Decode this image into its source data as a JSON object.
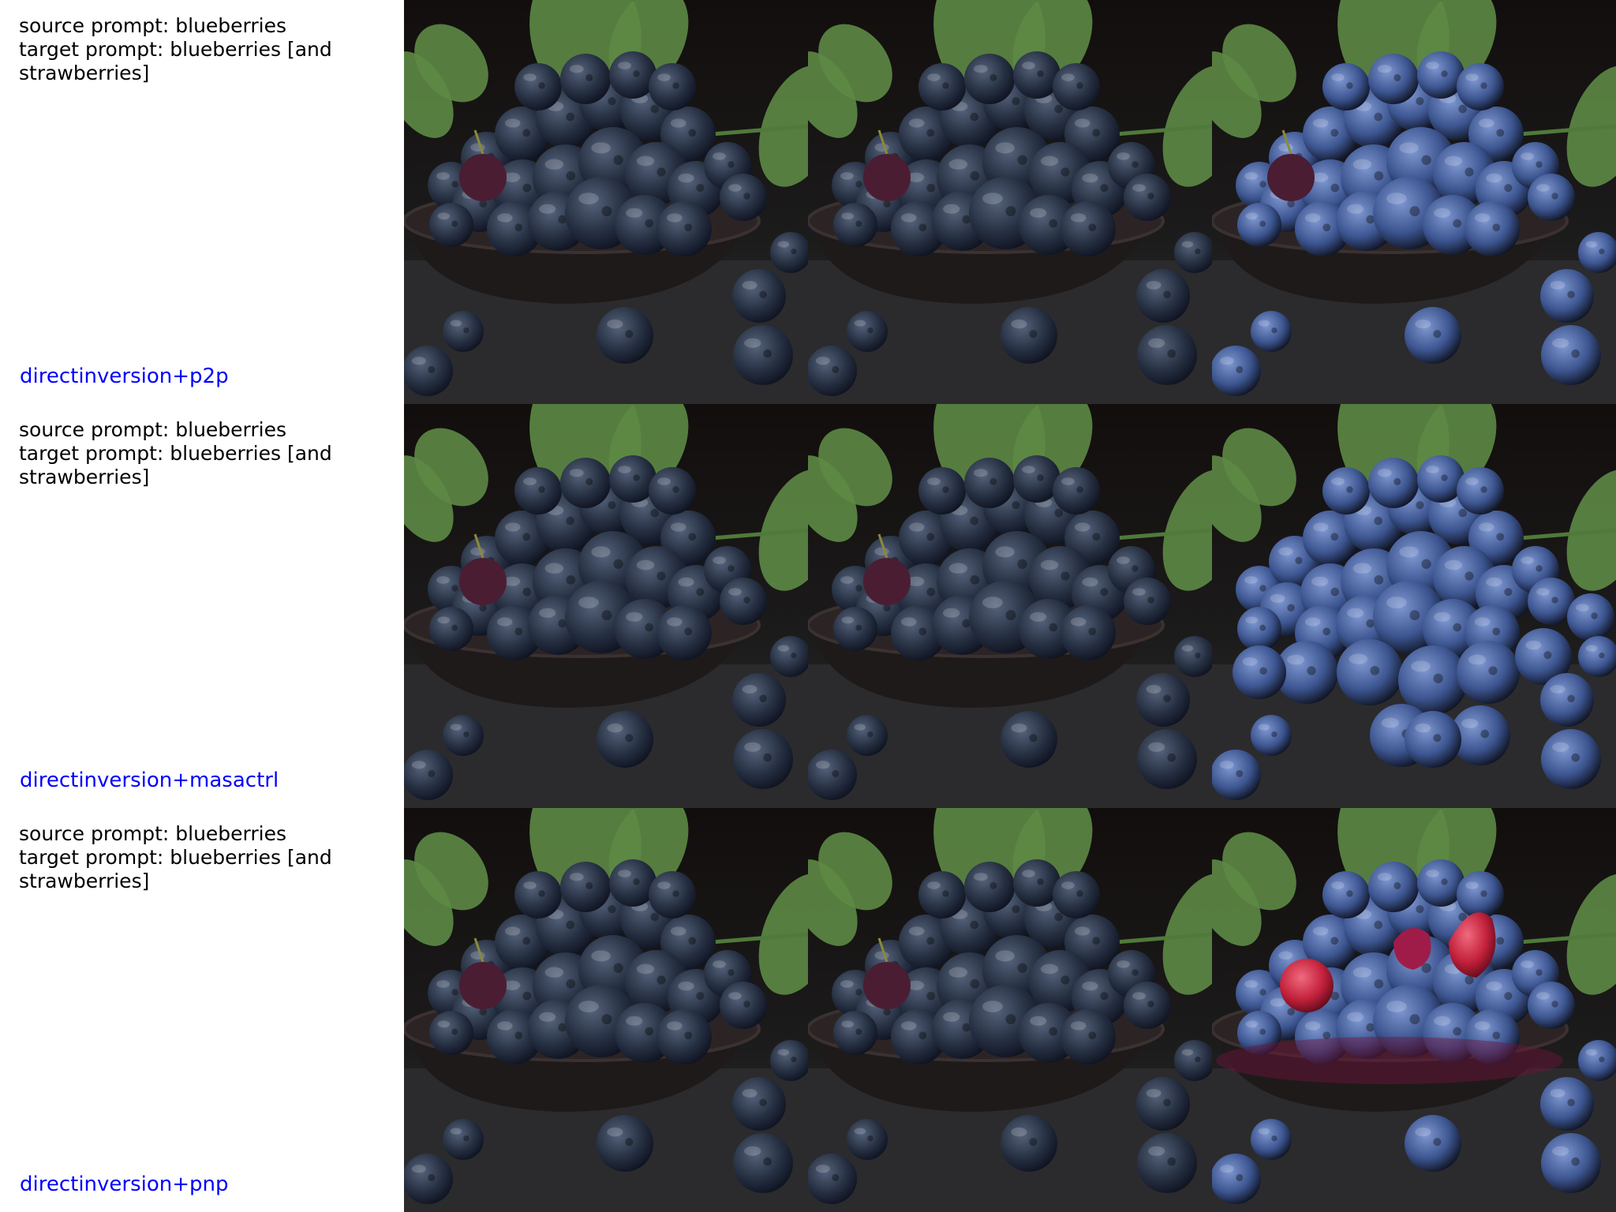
{
  "rows": [
    {
      "source_prompt": "source prompt: blueberries",
      "target_prompt": "target prompt: blueberries [and strawberries]",
      "method": "directinversion+p2p",
      "images": [
        {
          "variant": "dark"
        },
        {
          "variant": "dark"
        },
        {
          "variant": "blue"
        }
      ]
    },
    {
      "source_prompt": "source prompt: blueberries",
      "target_prompt": "target prompt: blueberries [and strawberries]",
      "method": "directinversion+masactrl",
      "images": [
        {
          "variant": "dark"
        },
        {
          "variant": "dark"
        },
        {
          "variant": "pile"
        }
      ]
    },
    {
      "source_prompt": "source prompt: blueberries",
      "target_prompt": "target prompt: blueberries [and strawberries]",
      "method": "directinversion+pnp",
      "images": [
        {
          "variant": "dark"
        },
        {
          "variant": "dark"
        },
        {
          "variant": "straw"
        }
      ]
    }
  ],
  "colors": {
    "method_label": "#0000ff",
    "background_dark": "#1b1a1a",
    "table": "#2b2b2d",
    "leaf": "#5d8a45",
    "berry_dark": "#263042",
    "berry_blue": "#3c5590",
    "strawberry": "#c2203a"
  }
}
